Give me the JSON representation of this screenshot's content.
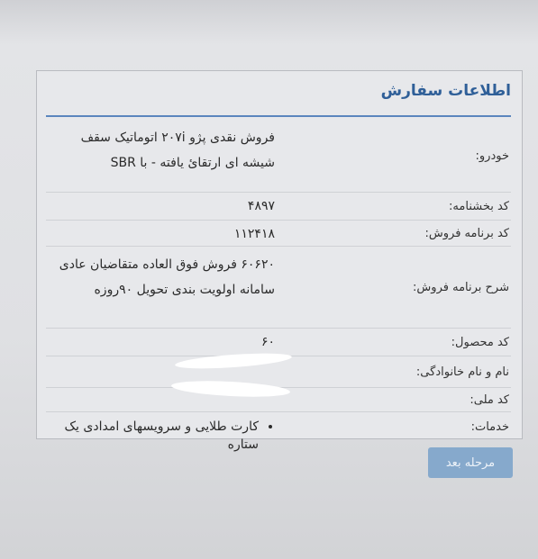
{
  "order_info": {
    "title": "اطلاعات سفارش",
    "rows": [
      {
        "label": "خودرو:",
        "value": "فروش نقدی پژو ۲۰۷i اتوماتیک سقف شیشه ای ارتقائ یافته - با SBR"
      },
      {
        "label": "کد بخشنامه:",
        "value": "۴۸۹۷"
      },
      {
        "label": "کد برنامه فروش:",
        "value": "۱۱۲۴۱۸"
      },
      {
        "label": "شرح برنامه فروش:",
        "value": "۶۰۶۲۰ فروش فوق العاده متقاضیان عادی سامانه اولویت بندی تحویل ۹۰روزه"
      },
      {
        "label": "کد محصول:",
        "value": "۶۰"
      },
      {
        "label": "نام و نام خانوادگی:",
        "value": ""
      },
      {
        "label": "کد ملی:",
        "value": ""
      },
      {
        "label": "خدمات:",
        "services": [
          "کارت طلایی و سرویسهای امدادی یک ستاره"
        ]
      }
    ]
  },
  "actions": {
    "next_label": "مرحله بعد"
  }
}
